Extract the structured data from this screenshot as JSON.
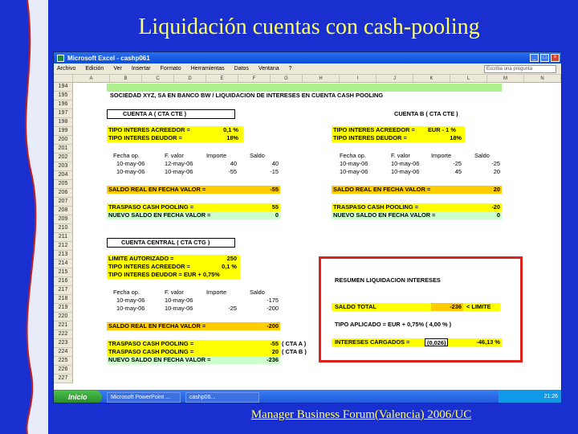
{
  "slide_title": "Liquidación cuentas con cash-pooling",
  "footer": "Manager Business Forum(Valencia) 2006/UC",
  "window": {
    "title": "Microsoft Excel - cashp061"
  },
  "menu": [
    "Archivo",
    "Edición",
    "Ver",
    "Insertar",
    "Formato",
    "Herramientas",
    "Datos",
    "Ventana",
    "?"
  ],
  "help_placeholder": "Escriba una pregunta",
  "columns": [
    "A",
    "B",
    "C",
    "D",
    "E",
    "F",
    "G",
    "H",
    "I",
    "J",
    "K",
    "L",
    "M",
    "N"
  ],
  "rows": [
    "194",
    "195",
    "196",
    "197",
    "198",
    "199",
    "200",
    "201",
    "202",
    "203",
    "204",
    "205",
    "206",
    "207",
    "208",
    "209",
    "210",
    "211",
    "212",
    "213",
    "214",
    "215",
    "216",
    "217",
    "218",
    "219",
    "220",
    "221",
    "222",
    "223",
    "224",
    "225",
    "226",
    "227"
  ],
  "sheet": {
    "header": "SOCIEDAD XYZ, SA EN BANCO BW / LIQUIDACION DE INTERESES EN CUENTA CASH POOLING",
    "cuenta_a": {
      "title": "CUENTA A ( CTA CTE )",
      "acreedor_label": "TIPO INTERES ACREEDOR =",
      "acreedor_val": "0,1 %",
      "deudor_label": "TIPO INTERES DEUDOR =",
      "deudor_val": "18%",
      "headers": [
        "Fecha op.",
        "F. valor",
        "Importe",
        "Saldo"
      ],
      "rows": [
        [
          "10-may-06",
          "12-may-06",
          "40",
          "40"
        ],
        [
          "10-may-06",
          "10-may-06",
          "-55",
          "-15"
        ]
      ],
      "saldo_label": "SALDO REAL EN FECHA VALOR =",
      "saldo_val": "-55",
      "traspaso_label": "TRASPASO CASH POOLING =",
      "traspaso_val": "55",
      "nuevo_label": "NUEVO SALDO EN FECHA VALOR =",
      "nuevo_val": "0"
    },
    "cuenta_b": {
      "title": "CUENTA B ( CTA CTE )",
      "acreedor_label": "TIPO INTERES ACREEDOR =",
      "acreedor_val": "EUR - 1 %",
      "deudor_label": "TIPO INTERES DEUDOR =",
      "deudor_val": "18%",
      "headers": [
        "Fecha op.",
        "F. valor",
        "Importe",
        "Saldo"
      ],
      "rows": [
        [
          "10-may-06",
          "10-may-06",
          "-25",
          "-25"
        ],
        [
          "10-may-06",
          "10-may-06",
          "45",
          "20"
        ]
      ],
      "saldo_label": "SALDO REAL EN FECHA VALOR =",
      "saldo_val": "20",
      "traspaso_label": "TRASPASO CASH POOLING =",
      "traspaso_val": "-20",
      "nuevo_label": "NUEVO SALDO EN FECHA VALOR =",
      "nuevo_val": "0"
    },
    "central": {
      "title": "CUENTA CENTRAL ( CTA CTG )",
      "limite_label": "LIMITE AUTORIZADO =",
      "limite_val": "250",
      "acreedor_label": "TIPO INTERES ACREEDOR =",
      "acreedor_val": "0,1 %",
      "deudor_label": "TIPO INTERES DEUDOR = EUR + 0,75%",
      "headers": [
        "Fecha op.",
        "F. valor",
        "Importe",
        "Saldo"
      ],
      "rows": [
        [
          "10-may-06",
          "10-may-06",
          "",
          "-175"
        ],
        [
          "10-may-06",
          "10-may-06",
          "-25",
          "-200"
        ]
      ],
      "saldo_label": "SALDO REAL EN FECHA VALOR =",
      "saldo_val": "-200",
      "traspaso1_label": "TRASPASO CASH POOLING =",
      "traspaso1_val": "-55",
      "traspaso1_note": "( CTA A )",
      "traspaso2_label": "TRASPASO CASH POOLING =",
      "traspaso2_val": "20",
      "traspaso2_note": "( CTA B )",
      "nuevo_label": "NUEVO SALDO EN FECHA VALOR =",
      "nuevo_val": "-236"
    },
    "resumen": {
      "title": "RESUMEN LIQUIDACION INTERESES",
      "saldo_label": "SALDO TOTAL",
      "saldo_val": "-236",
      "saldo_note": "< LIMITE",
      "tipo_label": "TIPO APLICADO = EUR + 0,75% ( 4,00 % )",
      "intereses_label": "INTERESES CARGADOS =",
      "intereses_factor": "(0,026)",
      "intereses_val": "-46,13 %"
    }
  },
  "taskbar": {
    "start": "Inicio",
    "items": [
      "Microsoft PowerPoint ...",
      "cashp06..."
    ],
    "clock": "21:26"
  }
}
